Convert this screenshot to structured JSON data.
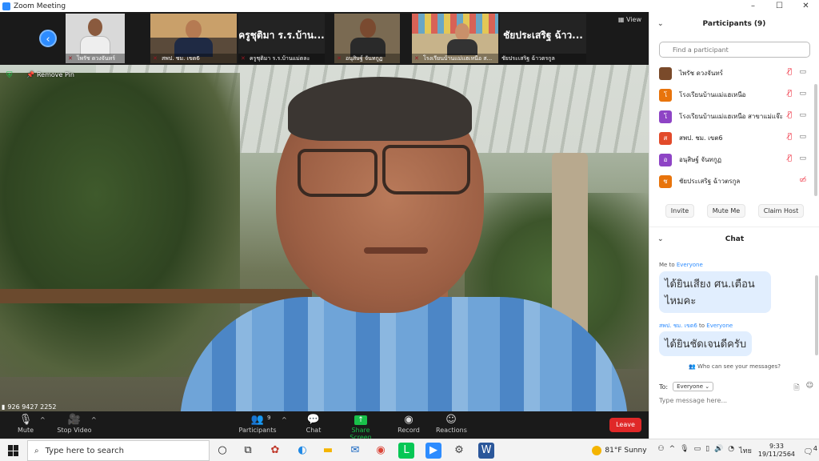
{
  "window": {
    "title": "Zoom Meeting",
    "controls": [
      "–",
      "☐",
      "✕"
    ]
  },
  "strip": {
    "view_label": "View",
    "thumbs": [
      {
        "name": "ไพรัช ดวงจันทร์",
        "big_name": ""
      },
      {
        "name": "สพป. ชม. เขต6",
        "big_name": ""
      },
      {
        "name": "ครูชุติมา ร.ร.บ้านแม่ตละ",
        "big_name": "ครูชุติมา ร.ร.บ้าน..."
      },
      {
        "name": "อนุสิษฐ์ จันทกูฏ",
        "big_name": ""
      },
      {
        "name": "โรงเรียนบ้านแม่แฮเหนือ ส...",
        "big_name": ""
      },
      {
        "name": "ชัยประเสริฐ ฉ้าวตรกูล",
        "big_name": "ชัยประเสริฐ ฉ้าว..."
      }
    ]
  },
  "video": {
    "remove_pin": "Remove Pin"
  },
  "toolbar": {
    "net_info": "926 9427 2252",
    "mute": "Mute",
    "stop_video": "Stop Video",
    "participants": "Participants",
    "participants_count": "9",
    "chat": "Chat",
    "share_screen": "Share Screen",
    "record": "Record",
    "reactions": "Reactions",
    "leave": "Leave"
  },
  "participants": {
    "title": "Participants (9)",
    "search_placeholder": "Find a participant",
    "list": [
      {
        "name": "ไพรัช ดวงจันทร์",
        "initial": "",
        "color": "#7a4a2a",
        "video_on": true
      },
      {
        "name": "โรงเรียนบ้านแม่แฮเหนือ",
        "initial": "โ",
        "color": "#e8740c",
        "video_on": true
      },
      {
        "name": "โรงเรียนบ้านแม่แฮเหนือ สาขาแม่แจ๊ะ",
        "initial": "โ",
        "color": "#8e44c5",
        "video_on": true
      },
      {
        "name": "สพป. ชม. เขต6",
        "initial": "ส",
        "color": "#e24a2a",
        "video_on": true
      },
      {
        "name": "อนุสิษฐ์ จันทกูฏ",
        "initial": "อ",
        "color": "#8e44c5",
        "video_on": true
      },
      {
        "name": "ชัยประเสริฐ ฉ้าวตรกูล",
        "initial": "ช",
        "color": "#e8740c",
        "video_on": false
      }
    ],
    "buttons": {
      "invite": "Invite",
      "mute_me": "Mute Me",
      "claim_host": "Claim Host"
    }
  },
  "chat": {
    "title": "Chat",
    "messages": [
      {
        "from": "Me",
        "to": "Everyone",
        "text": "ได้ยินเสียง ศน.เตือนไหมคะ"
      },
      {
        "from": "สพป. ชม. เขต6",
        "to": "Everyone",
        "text": "ได้ยินชัดเจนดีครับ"
      }
    ],
    "to_word": "to",
    "hint": "Who can see your messages?",
    "to_label": "To:",
    "to_value": "Everyone",
    "input_placeholder": "Type message here..."
  },
  "taskbar": {
    "search_placeholder": "Type here to search",
    "weather": "81°F  Sunny",
    "lang": "ไทย",
    "time": "9:33",
    "date": "19/11/2564",
    "notif_count": "4"
  },
  "colors": {
    "accent": "#2d8cff",
    "leave": "#e02828",
    "share": "#19c04a",
    "mic_off": "#ee2233"
  }
}
